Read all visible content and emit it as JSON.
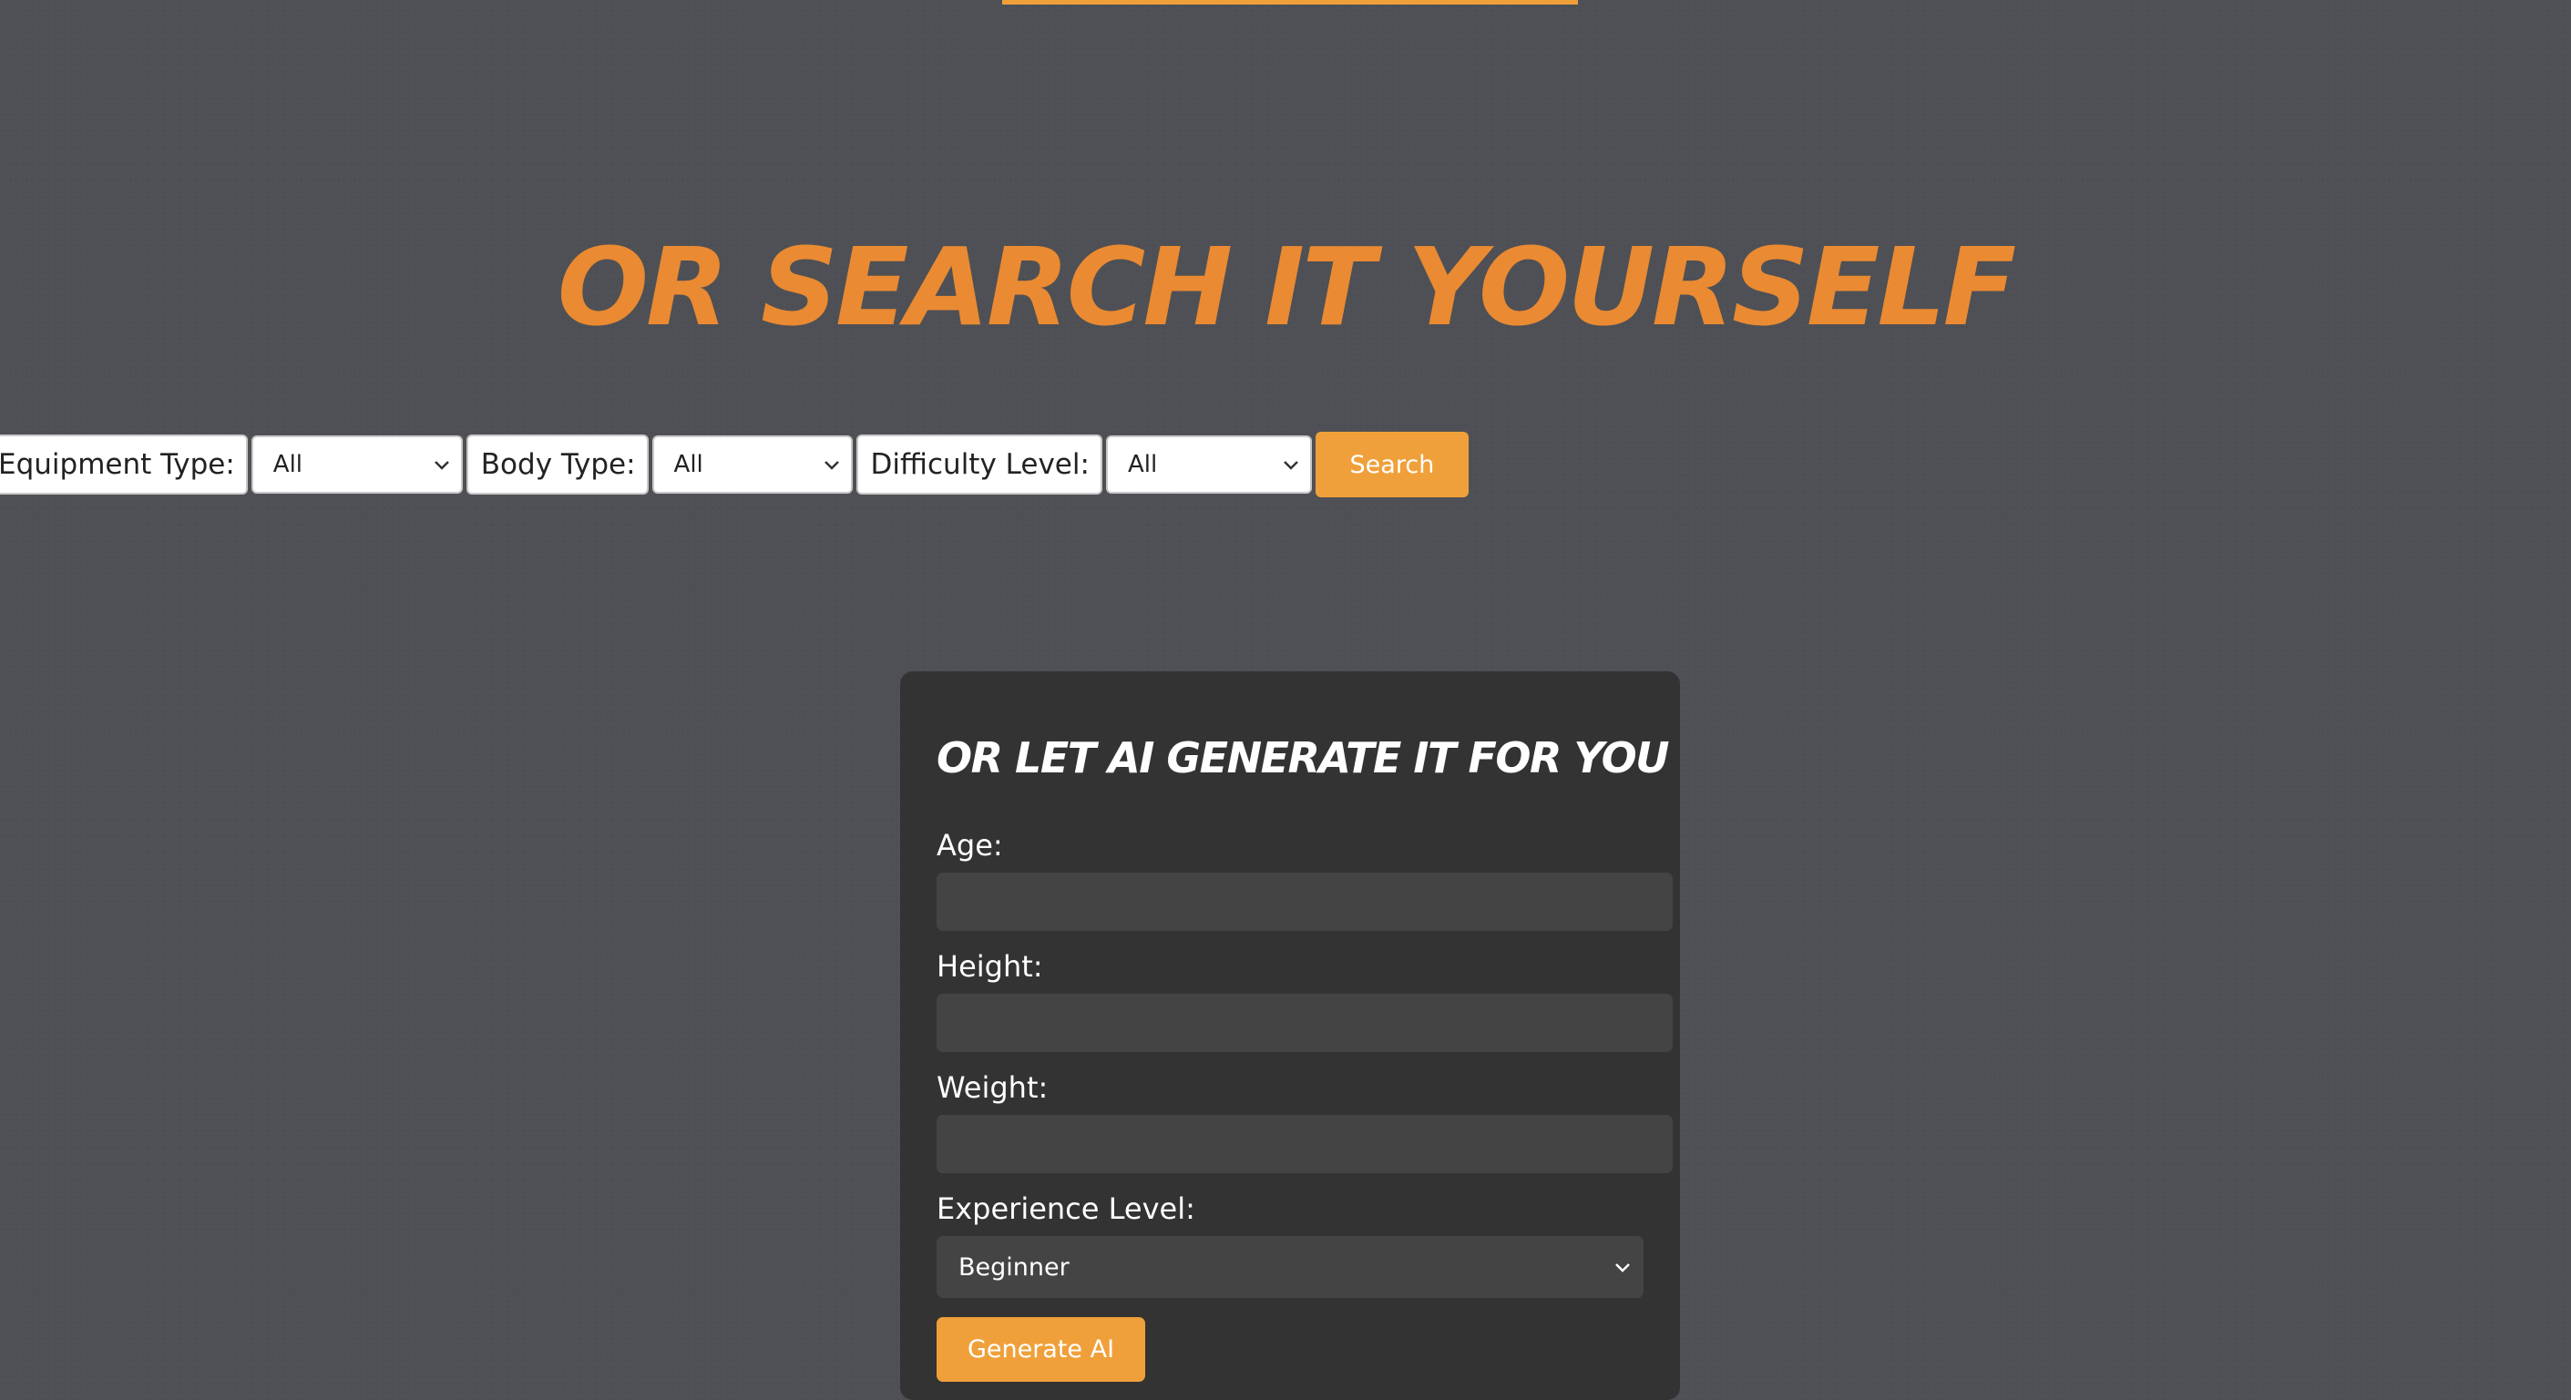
{
  "page": {
    "heading": "OR SEARCH IT YOURSELF"
  },
  "search_form": {
    "equipment_label": "Equipment Type:",
    "equipment_value": "All",
    "body_label": "Body Type:",
    "body_value": "All",
    "difficulty_label": "Difficulty Level:",
    "difficulty_value": "All",
    "search_button": "Search"
  },
  "ai_form": {
    "title": "OR LET AI GENERATE IT FOR YOU",
    "age_label": "Age:",
    "age_value": "",
    "height_label": "Height:",
    "height_value": "",
    "weight_label": "Weight:",
    "weight_value": "",
    "experience_label": "Experience Level:",
    "experience_value": "Beginner",
    "generate_button": "Generate AI"
  },
  "icons": {
    "select_arrow": "chevron-down-icon"
  },
  "colors": {
    "accent": "#f0a03a",
    "heading": "#ea8a32",
    "background": "#4e5055",
    "card": "#333333",
    "input": "#444444"
  }
}
